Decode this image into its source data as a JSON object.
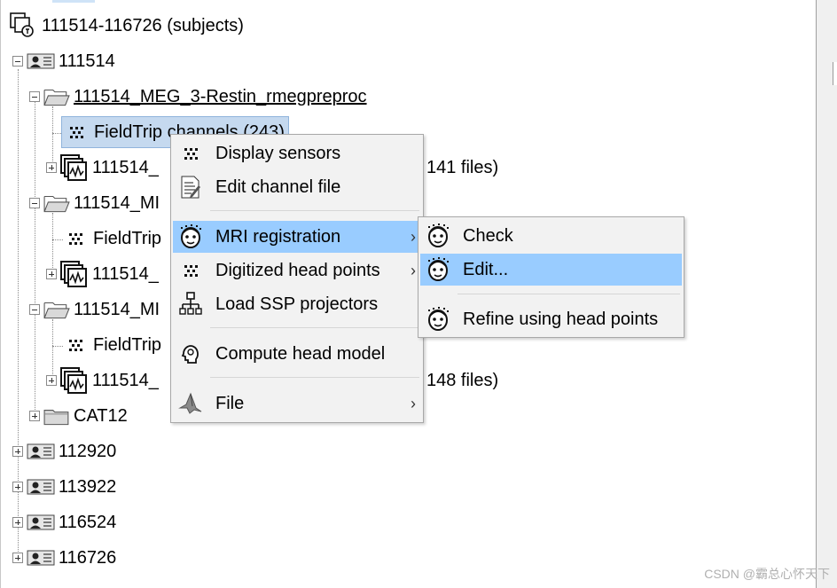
{
  "tree": {
    "root_label": "111514-116726 (subjects)",
    "subject_111514": "111514",
    "study_1_label": "111514_MEG_3-Restin_rmegpreproc",
    "channels_1_label": "FieldTrip channels (243)",
    "data_1_prefix": "111514_",
    "data_1_suffix": "141 files)",
    "study_2_prefix": "111514_MI",
    "channels_2_label": "FieldTrip",
    "data_2_prefix": "111514_",
    "study_3_prefix": "111514_MI",
    "channels_3_label": "FieldTrip",
    "data_3_prefix": "111514_",
    "data_3_suffix": "148 files)",
    "cat12_label": "CAT12",
    "subject_112920": "112920",
    "subject_113922": "113922",
    "subject_116524": "116524",
    "subject_116726": "116726"
  },
  "context_menu": {
    "display_sensors": "Display sensors",
    "edit_channel_file": "Edit channel file",
    "mri_registration": "MRI registration",
    "digitized_head_points": "Digitized head points",
    "load_ssp_projectors": "Load SSP projectors",
    "compute_head_model": "Compute head model",
    "file": "File",
    "submenu_arrow": "›"
  },
  "submenu": {
    "check": "Check",
    "edit": "Edit...",
    "refine": "Refine using head points"
  },
  "watermark": "CSDN @霸总心怀天下",
  "colors": {
    "selection_bg": "#c5d9ef",
    "menu_highlight": "#99ccff",
    "menu_bg": "#f2f2f2"
  }
}
